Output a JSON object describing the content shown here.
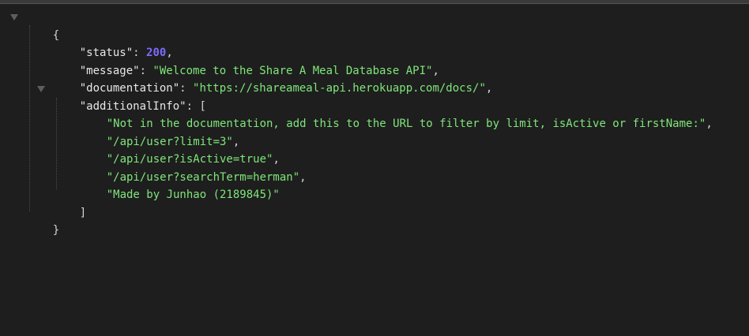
{
  "json_viewer": {
    "open_brace": "{",
    "close_brace": "}",
    "entries": [
      {
        "key": "\"status\"",
        "value": "200",
        "type": "number"
      },
      {
        "key": "\"message\"",
        "value": "\"Welcome to the Share A Meal Database API\"",
        "type": "string"
      },
      {
        "key": "\"documentation\"",
        "value": "\"https://shareameal-api.herokuapp.com/docs/\"",
        "type": "string"
      }
    ],
    "array_entry": {
      "key": "\"additionalInfo\"",
      "open_bracket": "[",
      "close_bracket": "]",
      "items": [
        "\"Not in the documentation, add this to the URL to filter by limit, isActive or firstName:\"",
        "\"/api/user?limit=3\"",
        "\"/api/user?isActive=true\"",
        "\"/api/user?searchTerm=herman\"",
        "\"Made by Junhao (2189845)\""
      ]
    },
    "separators": {
      "colon": ": ",
      "comma": ","
    },
    "colors": {
      "background": "#1e1e1e",
      "string": "#7fe67a",
      "number": "#7a6bff",
      "key": "#e8e8e8"
    }
  }
}
